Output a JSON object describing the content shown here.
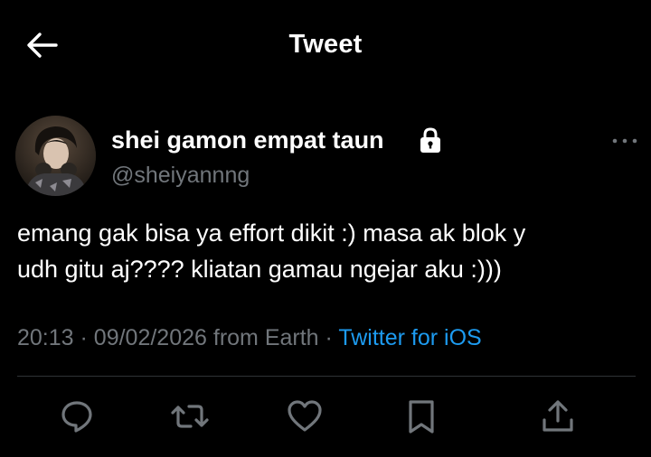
{
  "header": {
    "title": "Tweet",
    "back_icon": "arrow-left-icon"
  },
  "tweet": {
    "author": {
      "display_name": "shei gamon empat taun",
      "handle": "@sheiyannng",
      "protected_icon": "lock-icon",
      "avatar": "profile-photo"
    },
    "more_icon": "more-horizontal-icon",
    "text_lines": [
      "emang gak bisa ya effort dikit :) masa ak blok y",
      "udh gitu aj???? kliatan gamau ngejar aku :)))"
    ],
    "time": "20:13",
    "date": "09/02/2026",
    "location": "from Earth",
    "separator": "·",
    "source": "Twitter for iOS"
  },
  "actions": [
    {
      "name": "reply",
      "icon": "reply-icon"
    },
    {
      "name": "retweet",
      "icon": "retweet-icon"
    },
    {
      "name": "like",
      "icon": "heart-icon"
    },
    {
      "name": "bookmark",
      "icon": "bookmark-icon"
    },
    {
      "name": "share",
      "icon": "share-icon"
    }
  ],
  "colors": {
    "background": "#000000",
    "text_primary": "#ffffff",
    "text_secondary": "#71767b",
    "link": "#1d9bf0",
    "divider": "#2f3336"
  }
}
